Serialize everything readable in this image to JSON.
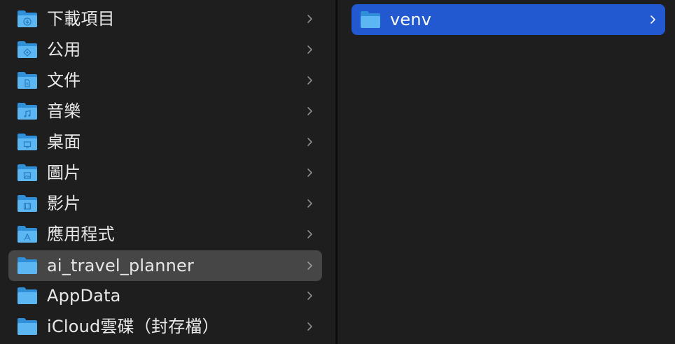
{
  "left_column": {
    "items": [
      {
        "label": "下載項目",
        "icon": "download-folder-icon"
      },
      {
        "label": "公用",
        "icon": "public-folder-icon"
      },
      {
        "label": "文件",
        "icon": "documents-folder-icon"
      },
      {
        "label": "音樂",
        "icon": "music-folder-icon"
      },
      {
        "label": "桌面",
        "icon": "desktop-folder-icon"
      },
      {
        "label": "圖片",
        "icon": "pictures-folder-icon"
      },
      {
        "label": "影片",
        "icon": "movies-folder-icon"
      },
      {
        "label": "應用程式",
        "icon": "applications-folder-icon"
      },
      {
        "label": "ai_travel_planner",
        "icon": "folder-icon",
        "selected": true
      },
      {
        "label": "AppData",
        "icon": "folder-icon"
      },
      {
        "label": "iCloud雲碟（封存檔）",
        "icon": "folder-icon"
      }
    ]
  },
  "right_column": {
    "items": [
      {
        "label": "venv",
        "icon": "folder-icon",
        "selected": true
      }
    ]
  },
  "colors": {
    "background": "#1e1e1e",
    "selection_inactive": "#464646",
    "selection_active": "#2259d0",
    "folder_light": "#5bb6f2",
    "folder_dark": "#2f8fd8",
    "text": "#e8e8e8",
    "chevron": "#8c8c8c"
  }
}
